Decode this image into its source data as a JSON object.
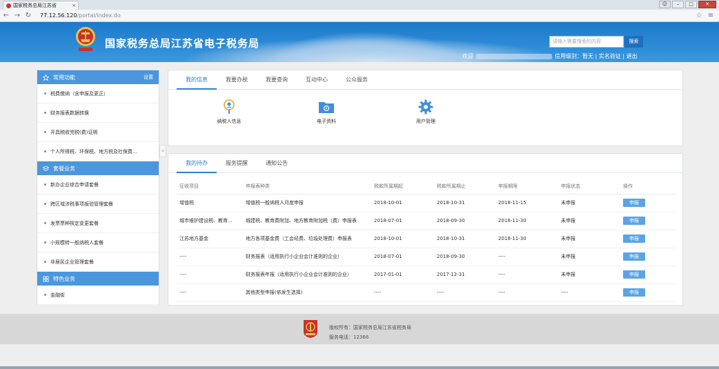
{
  "browser": {
    "tab_title": "国家税务总局江苏省",
    "url_host": "77.12.56.120",
    "url_path": "/portal/index.do"
  },
  "header": {
    "site_title": "国家税务总局江苏省电子税务局",
    "search_placeholder": "请输入需要搜索的内容",
    "search_button": "搜索",
    "welcome": "欢迎",
    "credit_level": "信用级别：暂无",
    "real_name_verify": "实名验证",
    "logout": "退出",
    "separator": "|",
    "brand_color": "#1d79c9"
  },
  "sidebar": {
    "sections": [
      {
        "title": "常用功能",
        "icon": "star-icon",
        "settings": "设置",
        "items": [
          "税费缴纳（含申报及更正）",
          "财务报表数据转换",
          "开具税收完税(费)证明",
          "个人所得税、环保税、地方税及社保费..."
        ]
      },
      {
        "title": "套餐业务",
        "icon": "layers-icon",
        "items": [
          "新办企业综合申请套餐",
          "跨区域涉税事项报验管理套餐",
          "发票票种核定变更套餐",
          "小规模转一般纳税人套餐",
          "非居民企业管理套餐"
        ]
      },
      {
        "title": "特色业务",
        "icon": "grid-icon",
        "items": [
          "金融街"
        ]
      }
    ],
    "collapse_glyph": "«"
  },
  "top_panel": {
    "tabs": [
      "我的信息",
      "我要办税",
      "我要查询",
      "互动中心",
      "公众服务"
    ],
    "active_tab": 0,
    "tiles": [
      {
        "label": "纳税人信息",
        "icon": "person-pin-icon"
      },
      {
        "label": "电子资料",
        "icon": "folder-icon"
      },
      {
        "label": "用户管理",
        "icon": "gear-icon"
      }
    ]
  },
  "todo_panel": {
    "tabs": [
      "我的待办",
      "服务提醒",
      "通知公告"
    ],
    "active_tab": 0,
    "columns": [
      "征收项目",
      "申报表种类",
      "税款所属期起",
      "税款所属期止",
      "申报期限",
      "申报状态",
      "操作"
    ],
    "rows": [
      [
        "增值税",
        "增值税一般纳税人月度申报",
        "2018-10-01",
        "2018-10-31",
        "2018-11-15",
        "未申报",
        "申报"
      ],
      [
        "城市维护建设税、教育...",
        "城建税、教育费附加、地方教育附加税（费）申报表",
        "2018-07-01",
        "2018-09-30",
        "2018-11-30",
        "未申报",
        "申报"
      ],
      [
        "江苏地方基金",
        "地方各项基金费（工会经费、垃圾处理费）申报表",
        "2018-10-01",
        "2018-10-31",
        "2018-11-30",
        "未申报",
        "申报"
      ],
      [
        "----",
        "财务报表（适用执行小企业会计准则的企业）",
        "2018-07-01",
        "2018-09-30",
        "----",
        "未申报",
        "申报"
      ],
      [
        "----",
        "财务报表年报（适用执行小企业会计准则的企业）",
        "2017-01-01",
        "2017-12-31",
        "----",
        "未申报",
        "申报"
      ],
      [
        "----",
        "其他类型申报(依发生选择)",
        "----",
        "----",
        "----",
        "----",
        "申报"
      ]
    ]
  },
  "footer": {
    "copyright": "版权所有：国家税务总局江苏省税务局",
    "phone": "服务电话：12366",
    "logo_text": "税务标志"
  }
}
